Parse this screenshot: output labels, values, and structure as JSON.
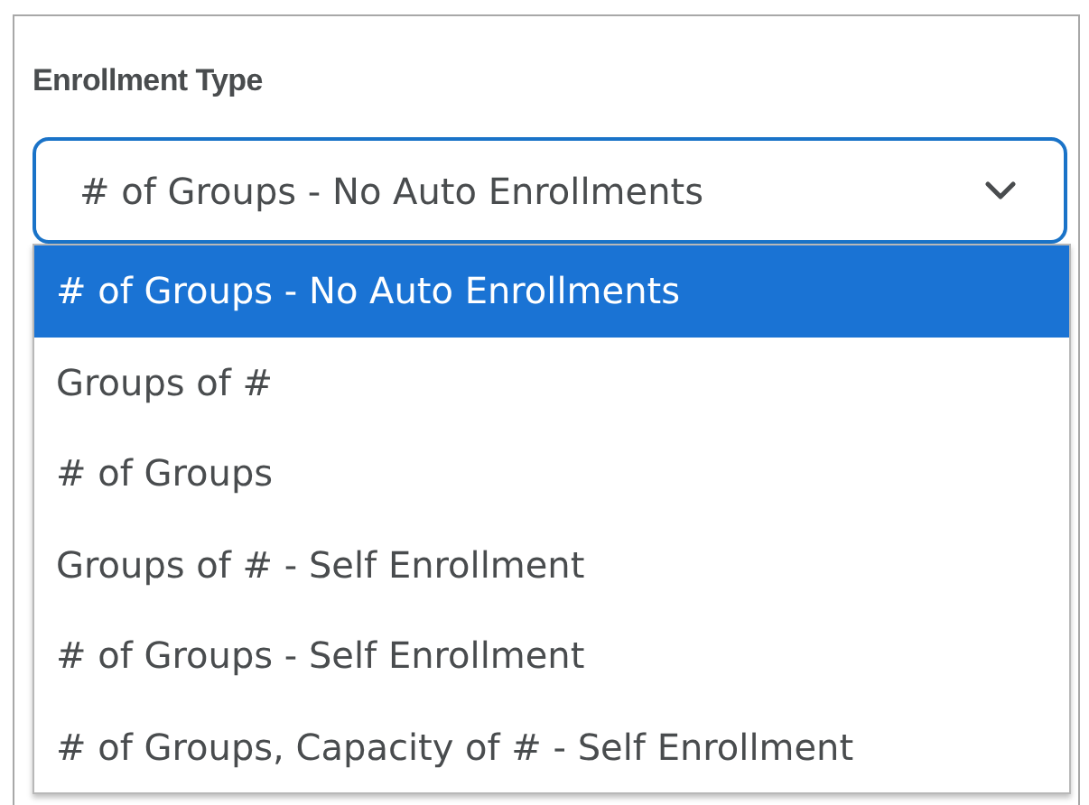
{
  "field": {
    "label": "Enrollment Type",
    "value": "# of Groups - No Auto Enrollments",
    "expanded": true
  },
  "options": [
    {
      "label": "# of Groups - No Auto Enrollments",
      "selected": true
    },
    {
      "label": "Groups of #",
      "selected": false
    },
    {
      "label": "# of Groups",
      "selected": false
    },
    {
      "label": "Groups of # - Self Enrollment",
      "selected": false
    },
    {
      "label": "# of Groups - Self Enrollment",
      "selected": false
    },
    {
      "label": "# of Groups, Capacity of # - Self Enrollment",
      "selected": false
    }
  ]
}
